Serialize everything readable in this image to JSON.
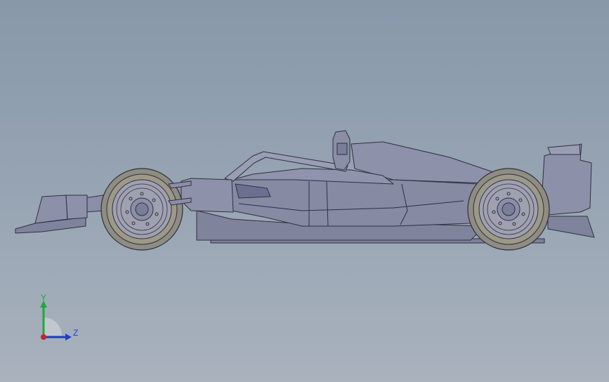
{
  "viewport": {
    "background_top": "#8898aa",
    "background_bottom": "#a9b2bd"
  },
  "model": {
    "body_color": "#8a8ea6",
    "body_shadow": "#6e7290",
    "edge_color": "#2f3040",
    "tire_color": "#8f8c82",
    "rim_color": "#9fa0b0"
  },
  "triad": {
    "y_label": "Y",
    "z_label": "Z",
    "y_color": "#1fa83a",
    "z_color": "#1a3fc8",
    "x_color": "#d02020"
  }
}
